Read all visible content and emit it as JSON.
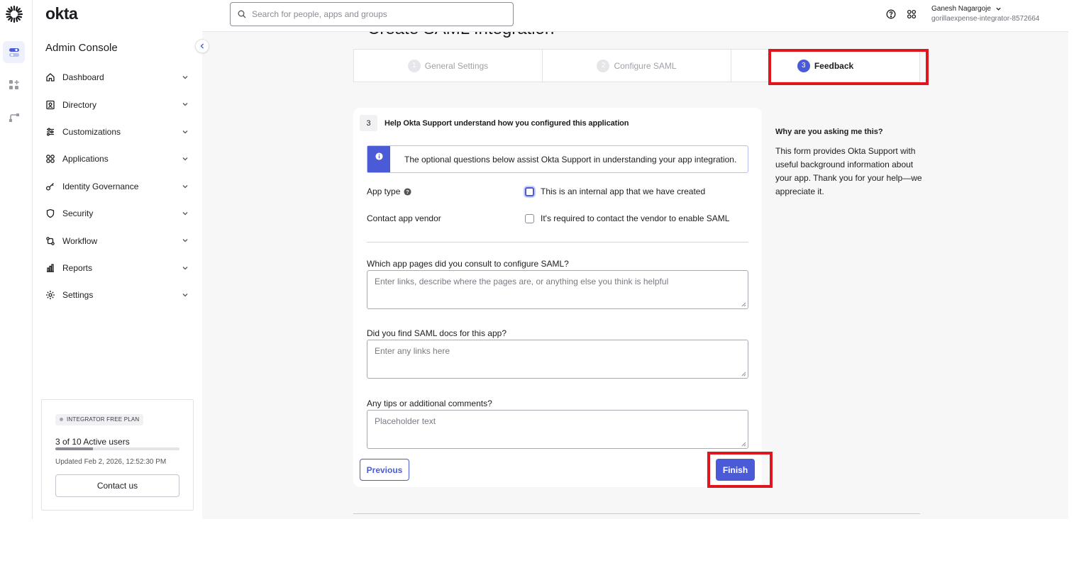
{
  "brand": {
    "name": "okta",
    "console_title": "Admin Console"
  },
  "search": {
    "placeholder": "Search for people, apps and groups"
  },
  "user": {
    "name": "Ganesh Nagargoje",
    "org": "gorillaexpense-integrator-8572664"
  },
  "nav": {
    "items": [
      {
        "label": "Dashboard",
        "icon": "home-icon"
      },
      {
        "label": "Directory",
        "icon": "directory-icon"
      },
      {
        "label": "Customizations",
        "icon": "customizations-icon"
      },
      {
        "label": "Applications",
        "icon": "applications-icon"
      },
      {
        "label": "Identity Governance",
        "icon": "key-icon"
      },
      {
        "label": "Security",
        "icon": "shield-icon"
      },
      {
        "label": "Workflow",
        "icon": "workflow-icon"
      },
      {
        "label": "Reports",
        "icon": "reports-icon"
      },
      {
        "label": "Settings",
        "icon": "gear-icon"
      }
    ]
  },
  "plan": {
    "badge": "INTEGRATOR FREE PLAN",
    "users_text": "3 of 10 Active users",
    "users_fraction": 0.3,
    "updated": "Updated Feb 2, 2026, 12:52:30 PM",
    "contact_label": "Contact us"
  },
  "page": {
    "title": "Create SAML Integration"
  },
  "steps": [
    {
      "num": "1",
      "label": "General Settings",
      "active": false
    },
    {
      "num": "2",
      "label": "Configure SAML",
      "active": false
    },
    {
      "num": "3",
      "label": "Feedback",
      "active": true
    }
  ],
  "form": {
    "section_num": "3",
    "section_title": "Help Okta Support understand how you configured this application",
    "info_text": "The optional questions below assist Okta Support in understanding your app integration.",
    "app_type_label": "App type",
    "app_type_option": "This is an internal app that we have created",
    "contact_vendor_label": "Contact app vendor",
    "contact_vendor_option": "It's required to contact the vendor to enable SAML",
    "q1_label": "Which app pages did you consult to configure SAML?",
    "q1_placeholder": "Enter links, describe where the pages are, or anything else you think is helpful",
    "q2_label": "Did you find SAML docs for this app?",
    "q2_placeholder": "Enter any links here",
    "q3_label": "Any tips or additional comments?",
    "q3_placeholder": "Placeholder text",
    "previous_label": "Previous",
    "finish_label": "Finish"
  },
  "aside": {
    "title": "Why are you asking me this?",
    "body": "This form provides Okta Support with useful background information about your app. Thank you for your help—we appreciate it."
  },
  "colors": {
    "accent": "#4b5bd8",
    "highlight": "#e0161f"
  }
}
